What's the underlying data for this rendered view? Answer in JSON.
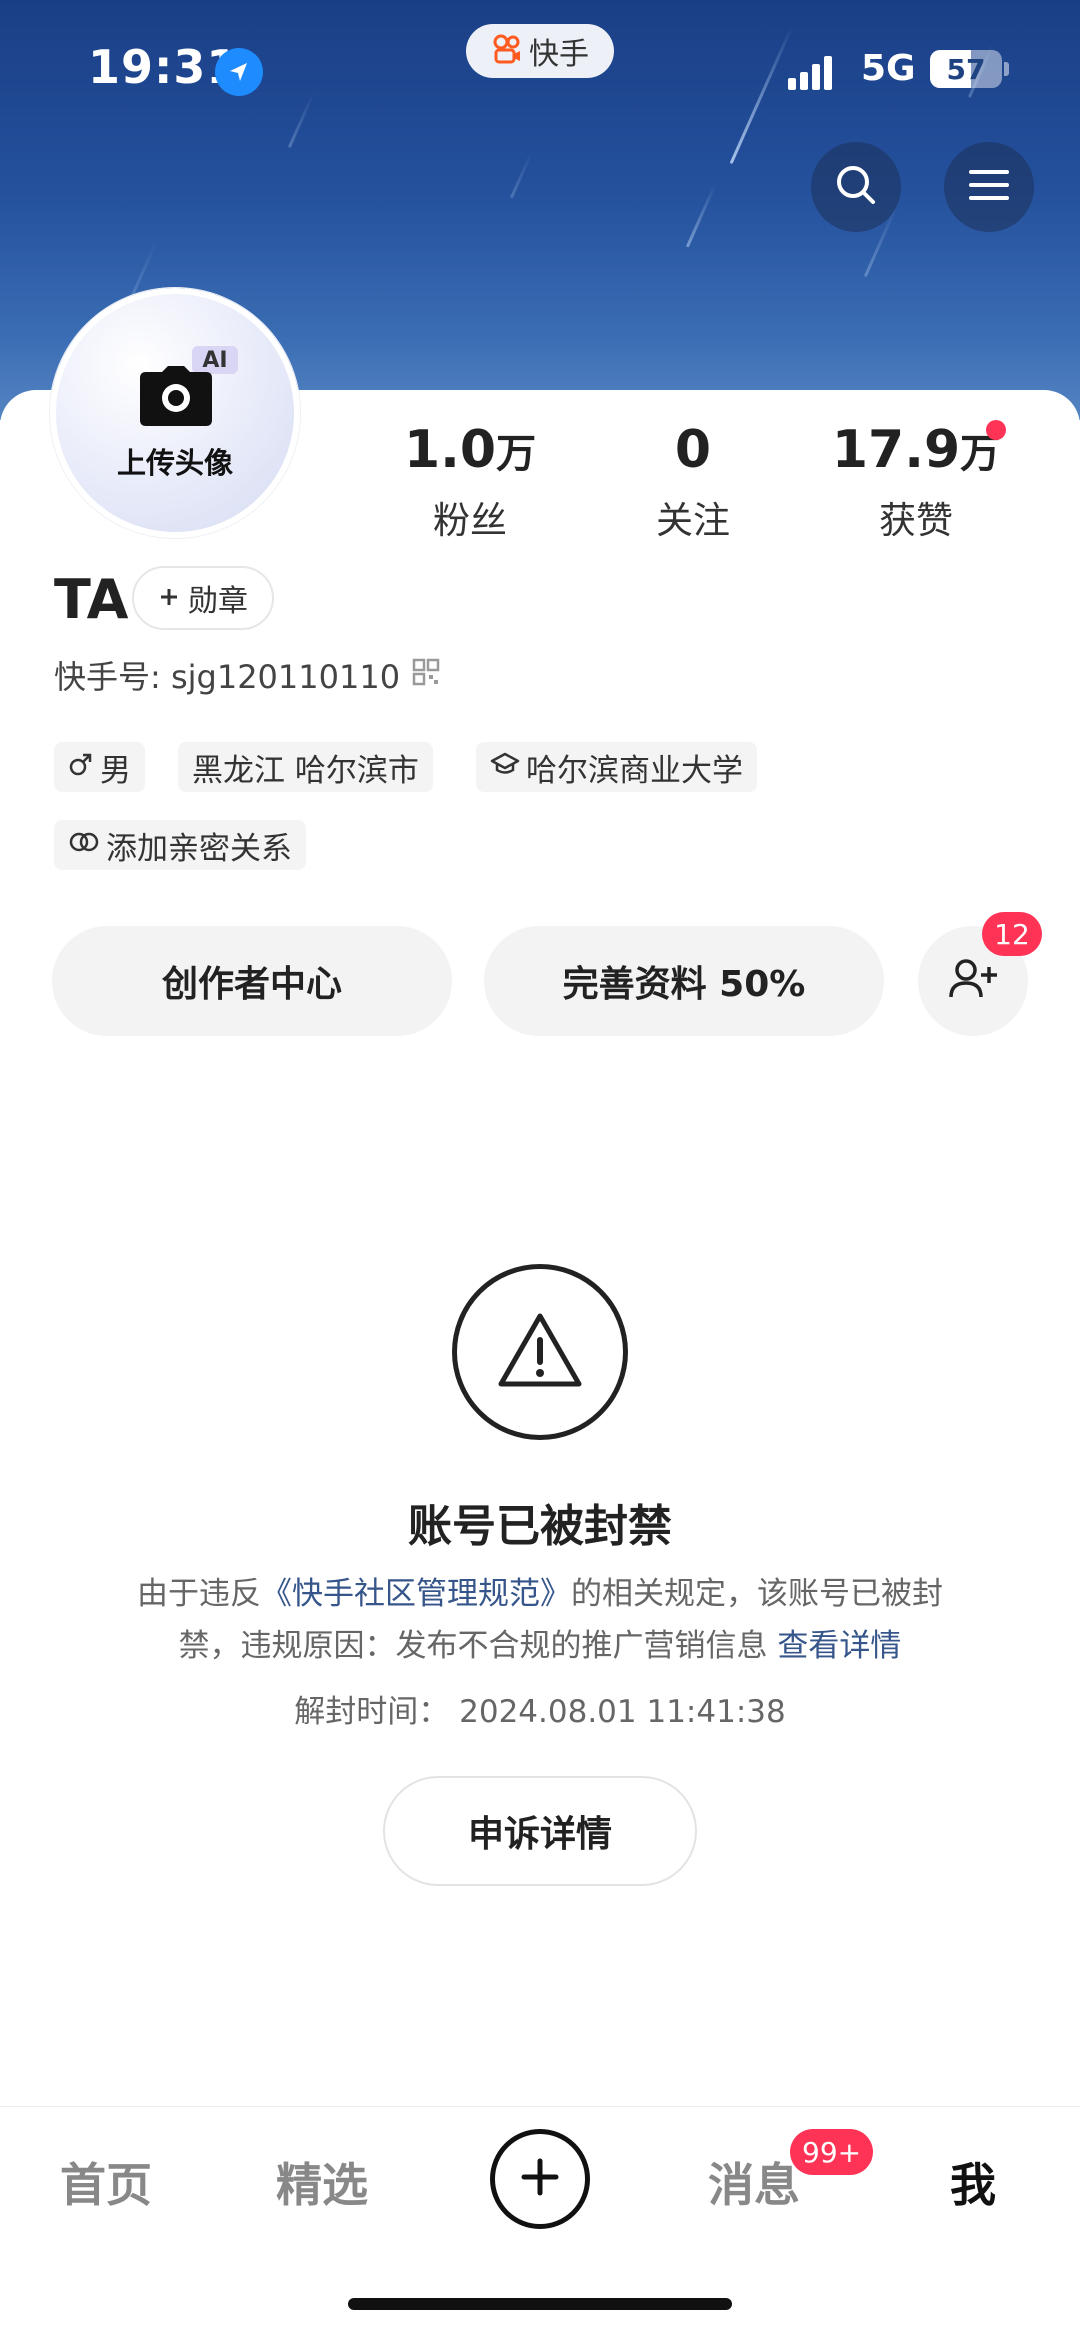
{
  "status_bar": {
    "time": "19:31",
    "network": "5G",
    "battery_level": "57",
    "battery_percent": 57,
    "app_name": "快手"
  },
  "header": {
    "search_icon": "search-icon",
    "menu_icon": "menu-icon"
  },
  "profile": {
    "avatar_upload_label": "上传头像",
    "ai_tag": "AI",
    "name": "TA",
    "medal_label": "勋章",
    "kuaishou_id": "快手号: sjg120110110",
    "stats": [
      {
        "number": "1.0",
        "unit": "万",
        "label": "粉丝"
      },
      {
        "number": "0",
        "unit": "",
        "label": "关注"
      },
      {
        "number": "17.9",
        "unit": "万",
        "label": "获赞"
      }
    ],
    "tags": {
      "gender": "男",
      "location": "黑龙江 哈尔滨市",
      "school": "哈尔滨商业大学",
      "relation": "添加亲密关系"
    }
  },
  "actions": {
    "creator_center": "创作者中心",
    "complete_profile": "完善资料 50%",
    "friend_requests_badge": "12"
  },
  "ban_notice": {
    "title": "账号已被封禁",
    "desc_prefix": "由于违反",
    "desc_link": "《快手社区管理规范》",
    "desc_middle": "的相关规定，该账号已被封禁，违规原因：发布不合规的推广营销信息 ",
    "desc_detail_link": "查看详情",
    "unban_time": "解封时间：  2024.08.01 11:41:38",
    "appeal_button": "申诉详情"
  },
  "bottom_nav": {
    "home": "首页",
    "featured": "精选",
    "messages": "消息",
    "messages_badge": "99+",
    "me": "我"
  },
  "colors": {
    "accent_red": "#fe3355",
    "link_blue": "#36558a",
    "banner_blue": "#24509c"
  }
}
